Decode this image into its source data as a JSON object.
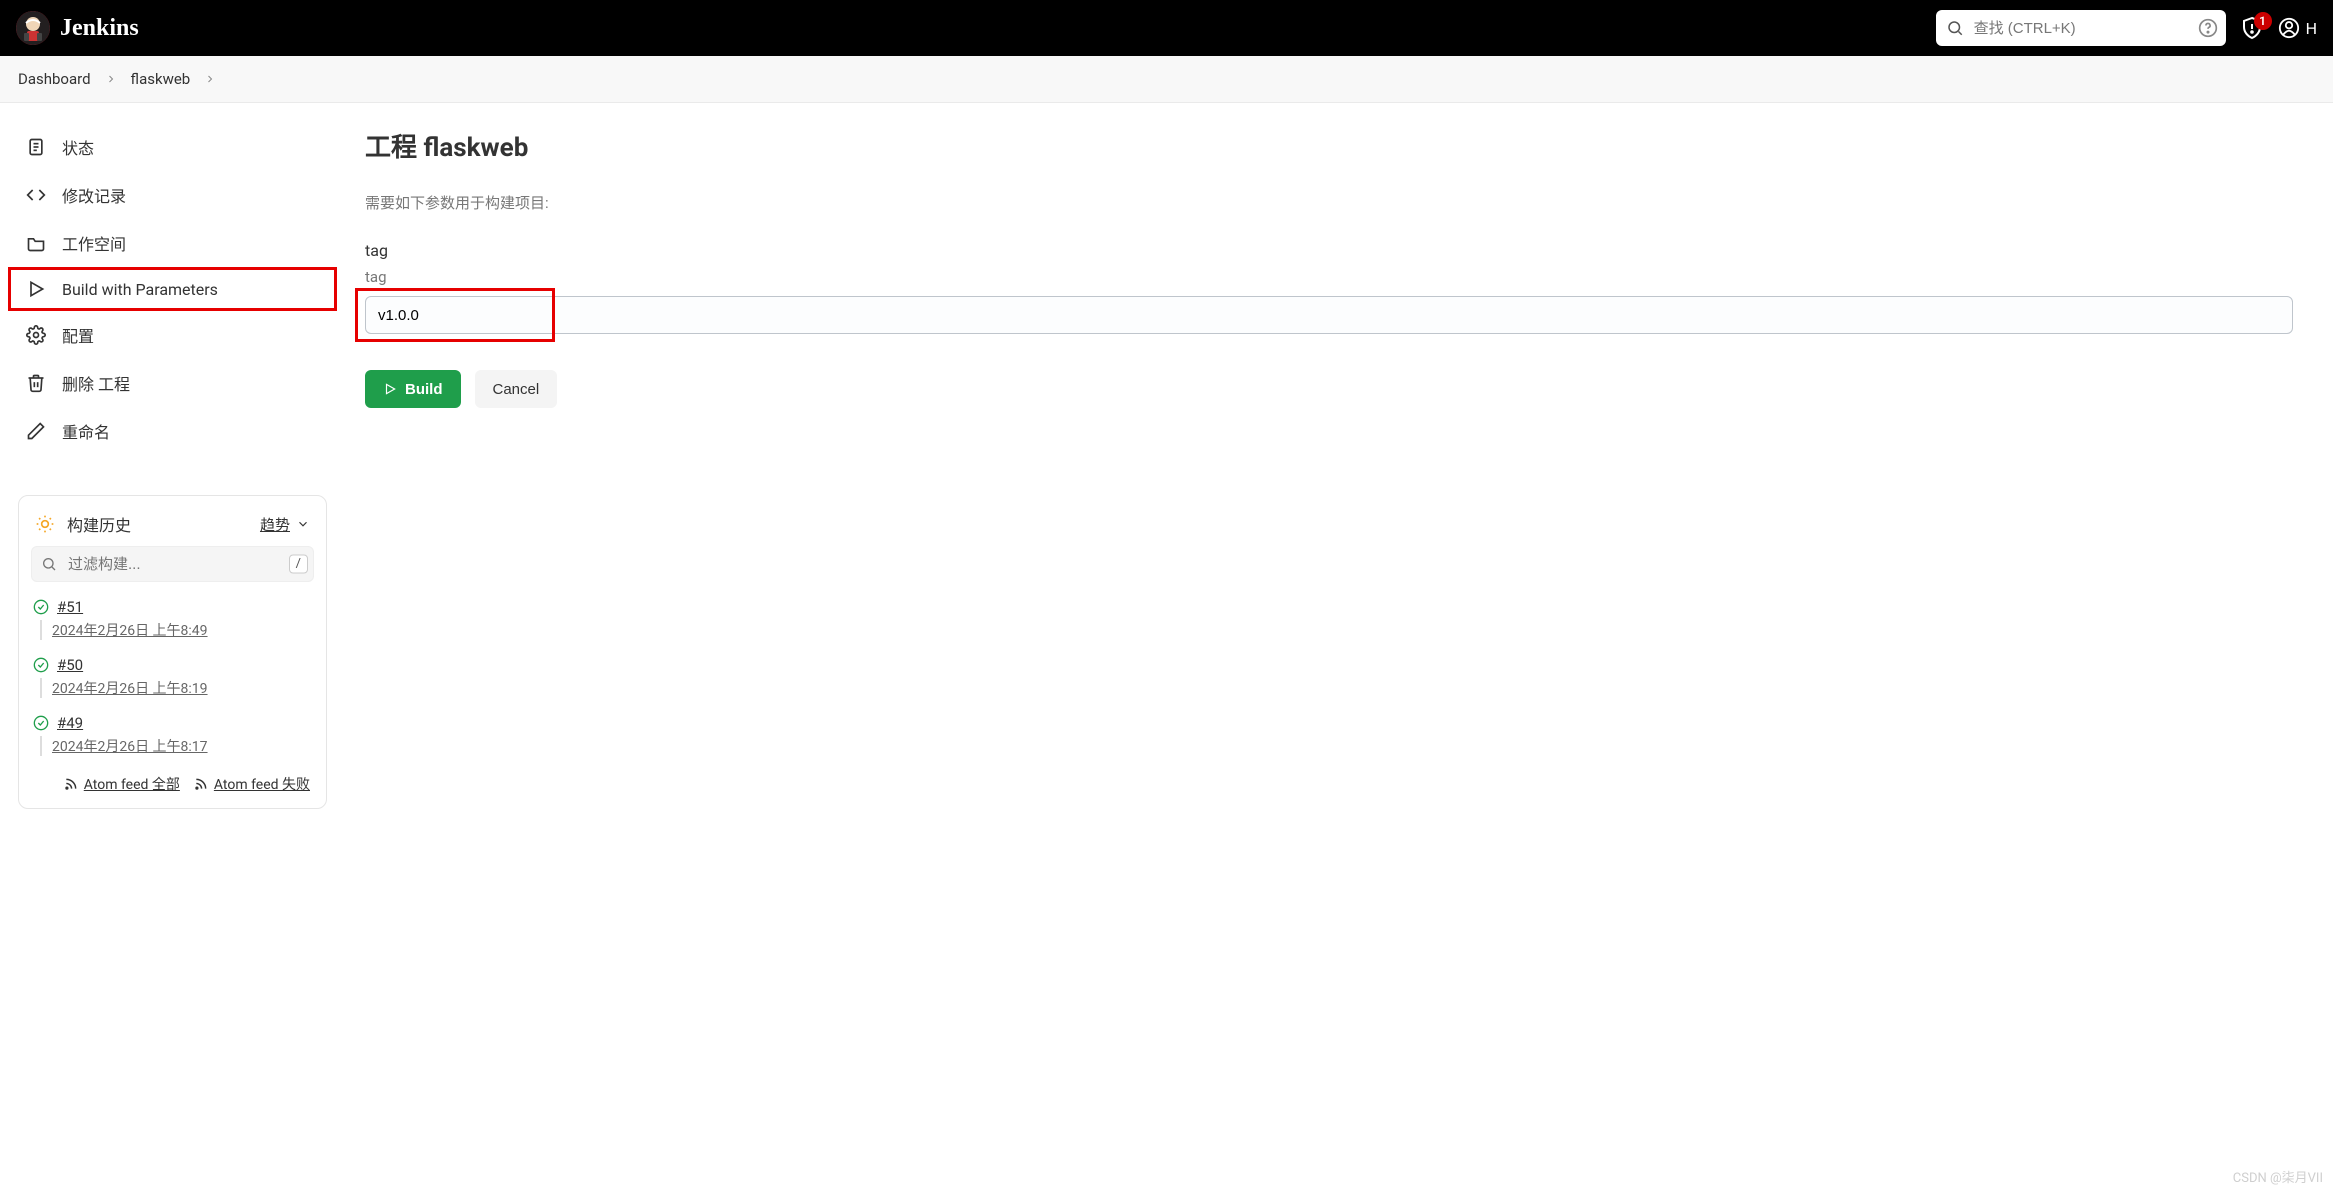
{
  "brand": {
    "name": "Jenkins"
  },
  "search": {
    "placeholder": "查找 (CTRL+K)"
  },
  "alerts": {
    "count": "1"
  },
  "user": {
    "label": "H"
  },
  "breadcrumbs": {
    "items": [
      "Dashboard",
      "flaskweb"
    ]
  },
  "sidebar": {
    "items": [
      {
        "label": "状态"
      },
      {
        "label": "修改记录"
      },
      {
        "label": "工作空间"
      },
      {
        "label": "Build with Parameters"
      },
      {
        "label": "配置"
      },
      {
        "label": "删除 工程"
      },
      {
        "label": "重命名"
      }
    ]
  },
  "history": {
    "title": "构建历史",
    "trend": "趋势",
    "filter_placeholder": "过滤构建...",
    "filter_key": "/",
    "builds": [
      {
        "id": "#51",
        "date": "2024年2月26日 上午8:49"
      },
      {
        "id": "#50",
        "date": "2024年2月26日 上午8:19"
      },
      {
        "id": "#49",
        "date": "2024年2月26日 上午8:17"
      }
    ],
    "rss": {
      "all": "Atom feed 全部",
      "fail": "Atom feed 失败"
    }
  },
  "main": {
    "title": "工程 flaskweb",
    "subtitle": "需要如下参数用于构建项目:",
    "param": {
      "name": "tag",
      "desc": "tag",
      "value": "v1.0.0"
    },
    "build_btn": "Build",
    "cancel_btn": "Cancel"
  },
  "watermark": "CSDN @柒月VII"
}
